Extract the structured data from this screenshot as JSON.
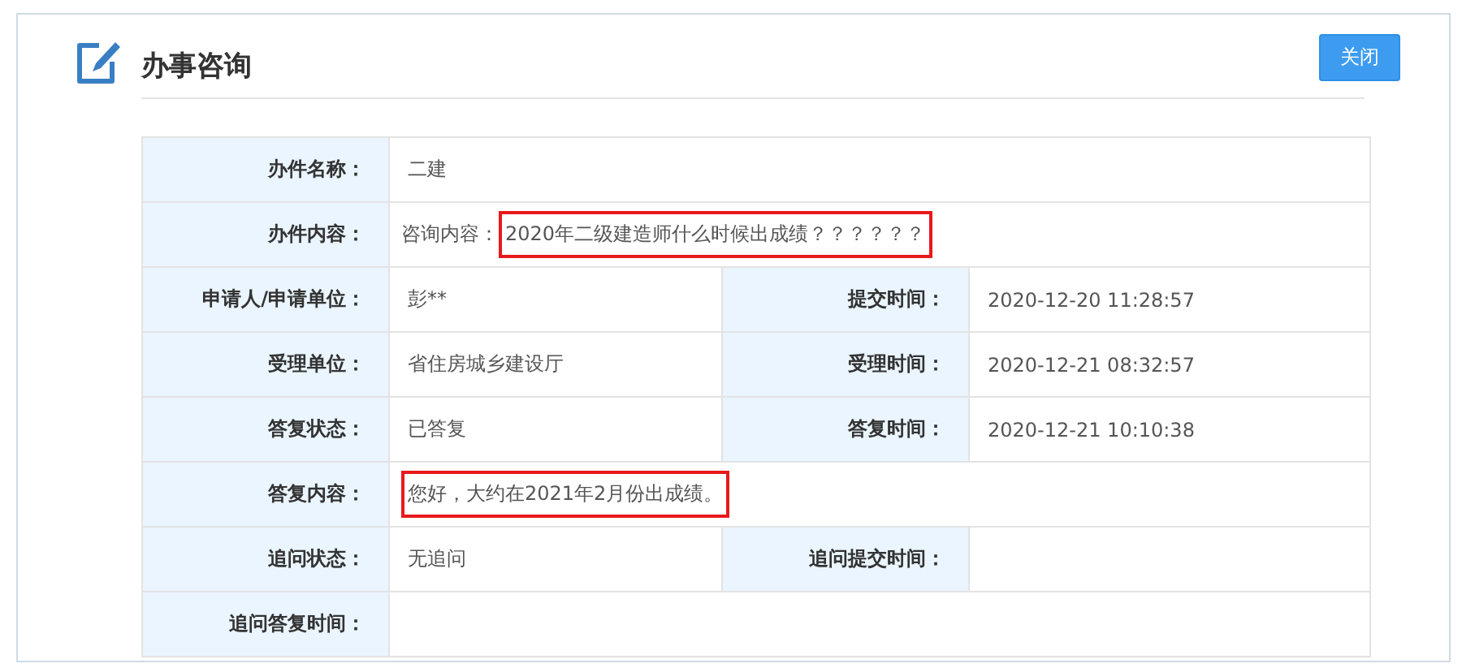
{
  "header": {
    "title": "办事咨询",
    "close_button": "关闭"
  },
  "rows": [
    {
      "fields": [
        {
          "label": "办件名称：",
          "value": "二建"
        }
      ]
    },
    {
      "fields": [
        {
          "label": "办件内容：",
          "prefix": "咨询内容：",
          "value": "2020年二级建造师什么时候出成绩？？？？？？",
          "highlighted": true
        }
      ]
    },
    {
      "fields": [
        {
          "label": "申请人/申请单位：",
          "value": "彭**"
        },
        {
          "label": "提交时间：",
          "value": "2020-12-20 11:28:57"
        }
      ]
    },
    {
      "fields": [
        {
          "label": "受理单位：",
          "value": "省住房城乡建设厅"
        },
        {
          "label": "受理时间：",
          "value": "2020-12-21 08:32:57"
        }
      ]
    },
    {
      "fields": [
        {
          "label": "答复状态：",
          "value": "已答复"
        },
        {
          "label": "答复时间：",
          "value": "2020-12-21 10:10:38"
        }
      ]
    },
    {
      "fields": [
        {
          "label": "答复内容：",
          "value": "您好，大约在2021年2月份出成绩。",
          "highlighted": true
        }
      ]
    },
    {
      "fields": [
        {
          "label": "追问状态：",
          "value": "无追问"
        },
        {
          "label": "追问提交时间："
        }
      ]
    },
    {
      "fields": [
        {
          "label": "追问答复时间："
        }
      ]
    }
  ]
}
